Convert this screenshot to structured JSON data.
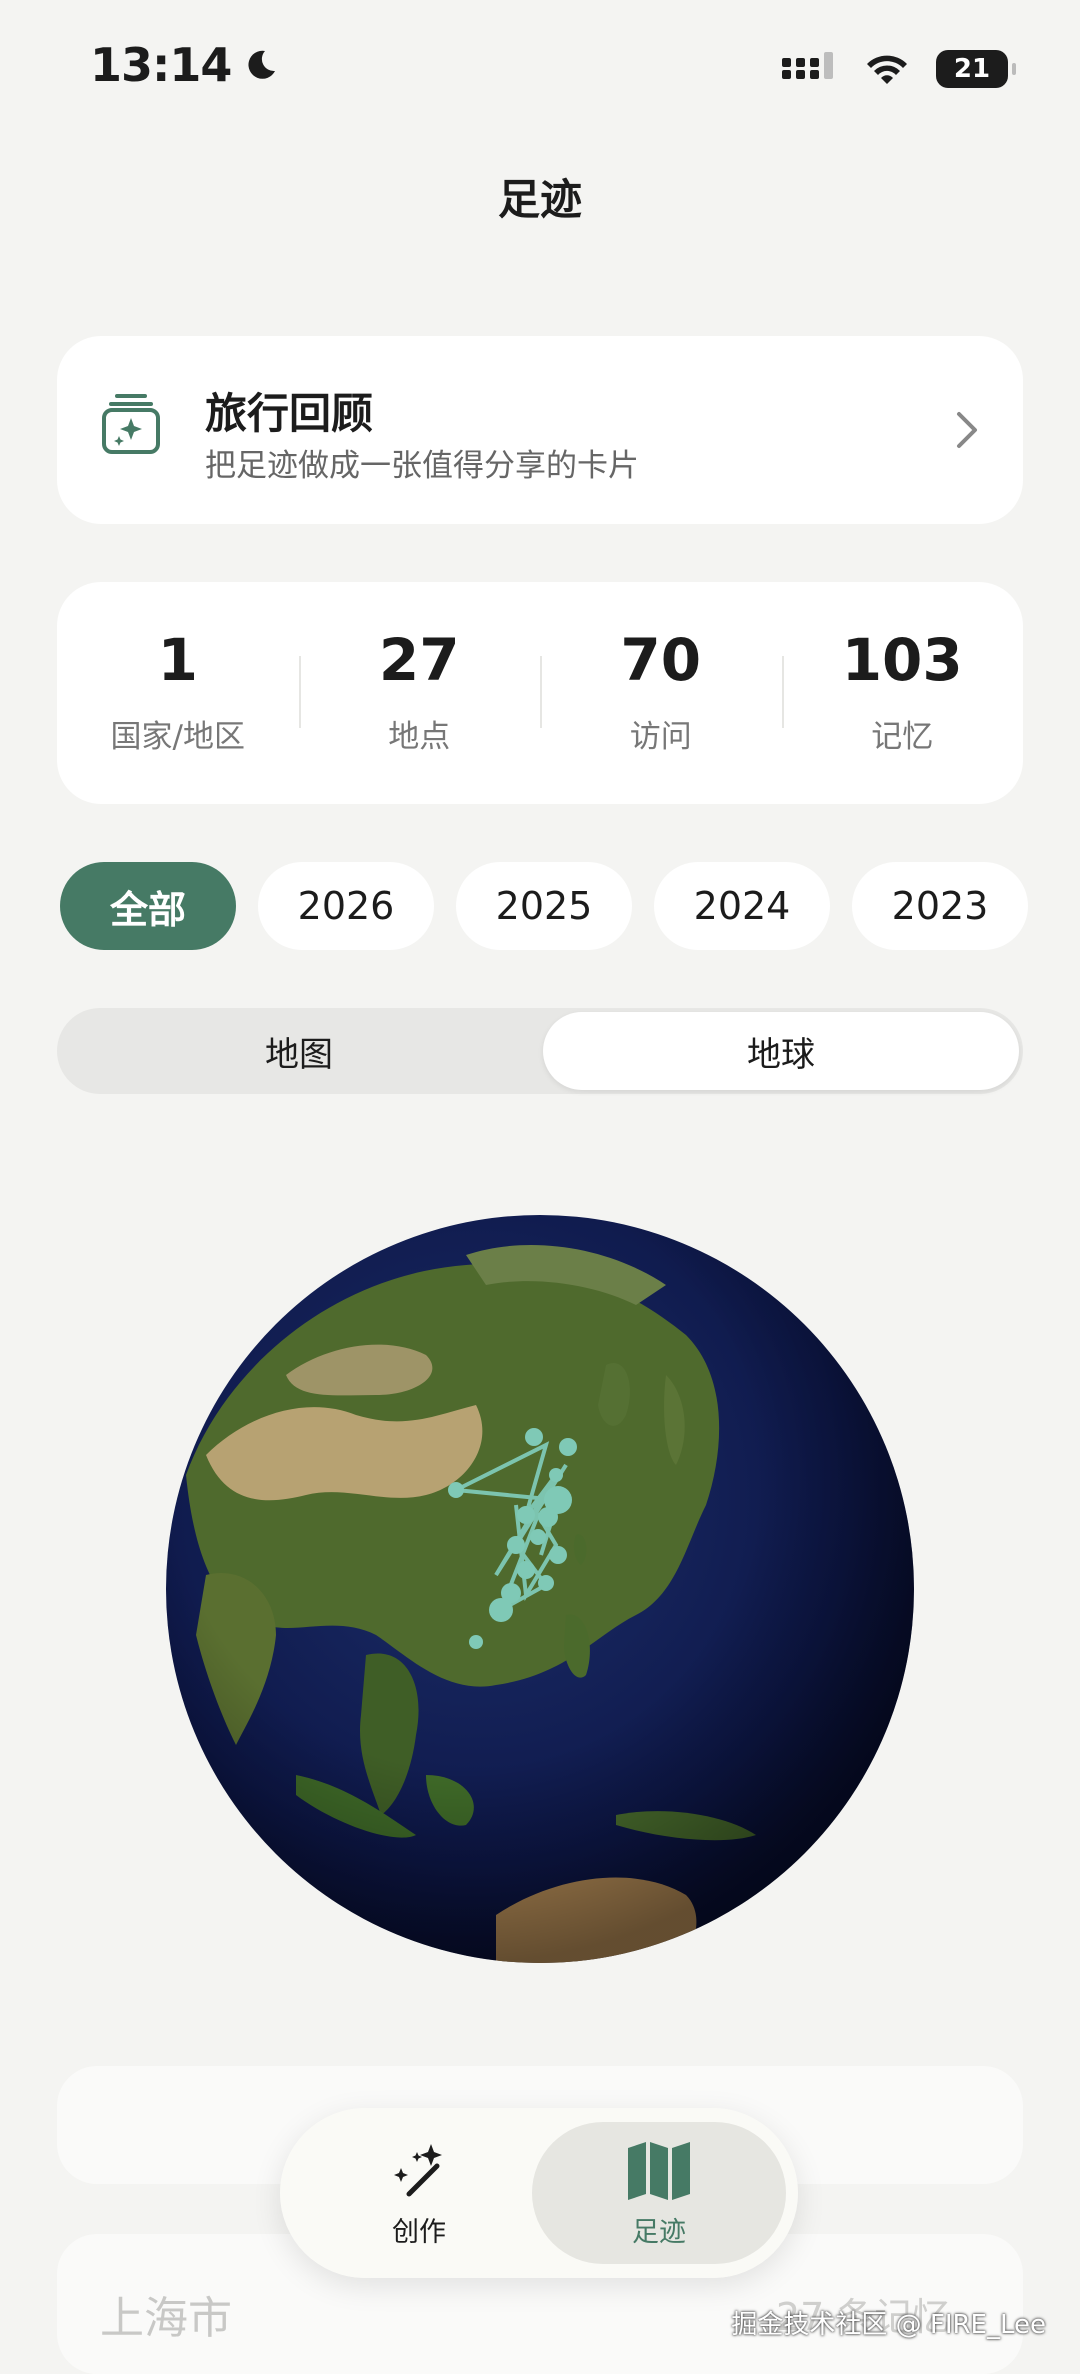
{
  "status_bar": {
    "time": "13:14",
    "battery": "21",
    "moon_icon": "moon-icon",
    "signal_icon": "signal-icon",
    "wifi_icon": "wifi-icon"
  },
  "page": {
    "title": "足迹"
  },
  "review_card": {
    "title": "旅行回顾",
    "subtitle": "把足迹做成一张值得分享的卡片",
    "icon": "sparkle-card-stack-icon"
  },
  "stats": [
    {
      "value": "1",
      "label": "国家/地区"
    },
    {
      "value": "27",
      "label": "地点"
    },
    {
      "value": "70",
      "label": "访问"
    },
    {
      "value": "103",
      "label": "记忆"
    }
  ],
  "year_filters": [
    "全部",
    "2026",
    "2025",
    "2024",
    "2023"
  ],
  "view_toggle": {
    "left": "地图",
    "right": "地球",
    "selected": "地球"
  },
  "list_preview": {
    "city": "上海市",
    "count": "27 条记忆"
  },
  "tabbar": {
    "create": "创作",
    "footprint": "足迹",
    "active": "足迹"
  },
  "watermark": "掘金技术社区 @ FIRE_Lee",
  "colors": {
    "accent": "#467a65",
    "route": "#7fc9b6",
    "background": "#f4f4f2"
  }
}
